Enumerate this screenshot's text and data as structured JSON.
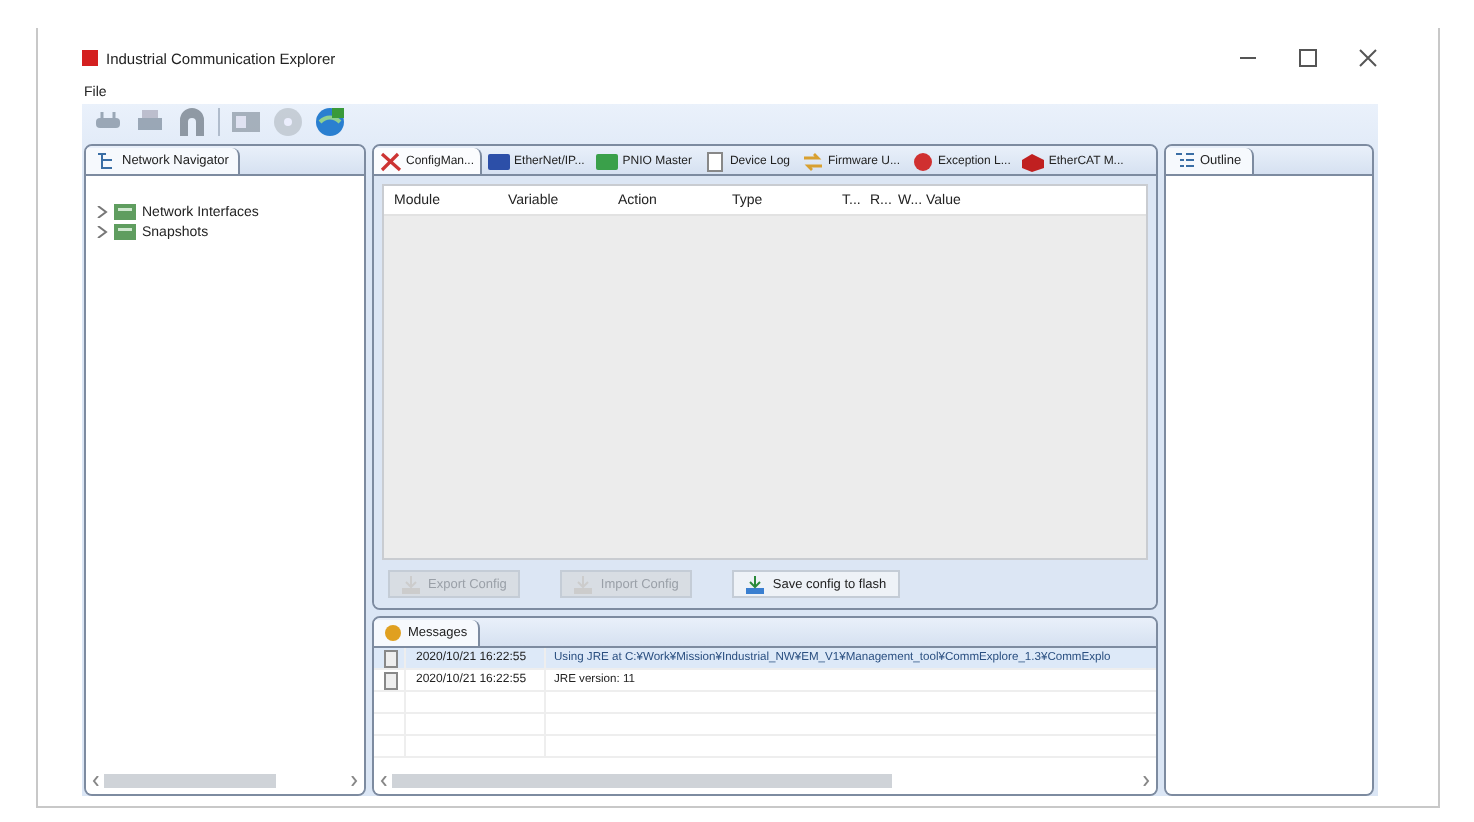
{
  "window": {
    "title": "Industrial Communication Explorer"
  },
  "menu": [
    "File"
  ],
  "toolbar": [
    {
      "kind": "plug",
      "disabled": true
    },
    {
      "kind": "printer",
      "disabled": true
    },
    {
      "kind": "arch",
      "disabled": true
    },
    {
      "kind": "card",
      "disabled": true
    },
    {
      "kind": "disc",
      "disabled": true
    },
    {
      "kind": "globe",
      "disabled": false
    }
  ],
  "navigator": {
    "tab": "Network Navigator",
    "items": [
      {
        "label": "Network Interfaces",
        "expanded": false
      },
      {
        "label": "Snapshots",
        "expanded": false
      }
    ]
  },
  "editor_tabs": [
    {
      "label": "ConfigMan...",
      "kind": "tools",
      "selected": true
    },
    {
      "label": "EtherNet/IP...",
      "kind": "eip",
      "selected": false
    },
    {
      "label": "PNIO Master",
      "kind": "pn",
      "selected": false
    },
    {
      "label": "Device Log",
      "kind": "doc",
      "selected": false
    },
    {
      "label": "Firmware U...",
      "kind": "arrows",
      "selected": false
    },
    {
      "label": "Exception L...",
      "kind": "error",
      "selected": false
    },
    {
      "label": "EtherCAT M...",
      "kind": "ecat",
      "selected": false
    }
  ],
  "table": {
    "columns": [
      "Module",
      "Variable",
      "Action",
      "Type",
      "T...",
      "R...",
      "W...",
      "Value"
    ]
  },
  "buttons": [
    {
      "label": "Export Config",
      "disabled": true
    },
    {
      "label": "Import Config",
      "disabled": true
    },
    {
      "label": "Save config to flash",
      "disabled": false
    }
  ],
  "messages": {
    "tab": "Messages",
    "rows": [
      {
        "time": "2020/10/21 16:22:55",
        "text": "Using JRE at C:¥Work¥Mission¥Industrial_NW¥EM_V1¥Management_tool¥CommExplore_1.3¥CommExplo",
        "selected": true
      },
      {
        "time": "2020/10/21 16:22:55",
        "text": "JRE version: 11",
        "selected": false
      }
    ]
  },
  "outline": {
    "tab": "Outline"
  }
}
